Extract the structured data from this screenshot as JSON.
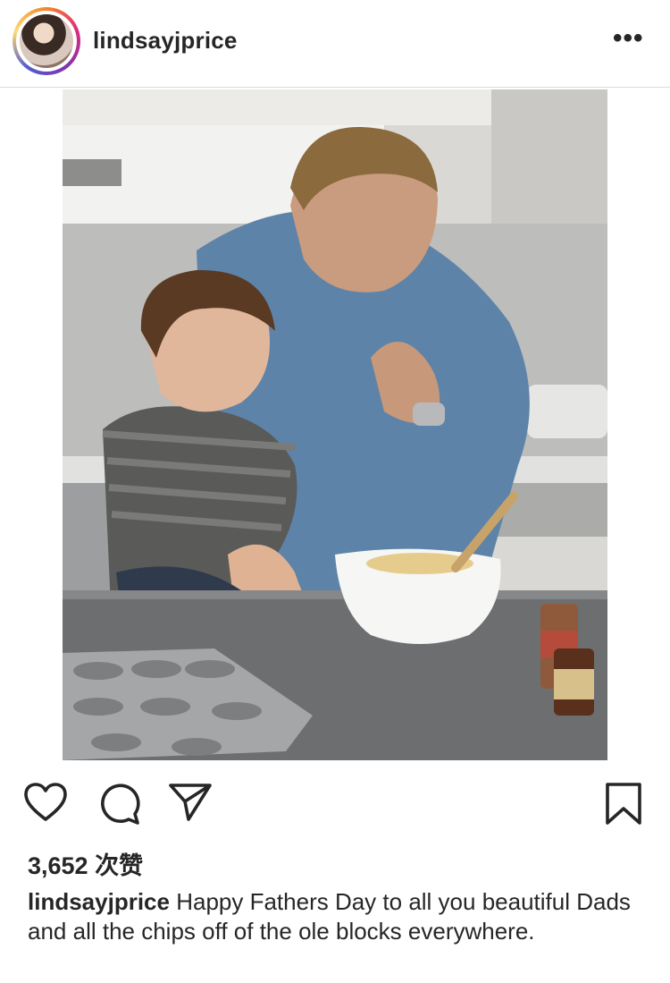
{
  "post": {
    "username": "lindsayjprice",
    "more_label": "•••",
    "likes": "3,652 次赞",
    "caption_user": "lindsayjprice",
    "caption_text": "Happy Fathers Day to all you beautiful Dads and all the chips off of the ole blocks everywhere."
  },
  "icons": {
    "like": "heart-icon",
    "comment": "comment-icon",
    "share": "share-icon",
    "save": "bookmark-icon",
    "more": "more-options-icon"
  },
  "colors": {
    "text": "#262626",
    "divider": "#dbdbdb",
    "story_ring": [
      "#f58529",
      "#dd2a7b",
      "#8134af"
    ]
  }
}
